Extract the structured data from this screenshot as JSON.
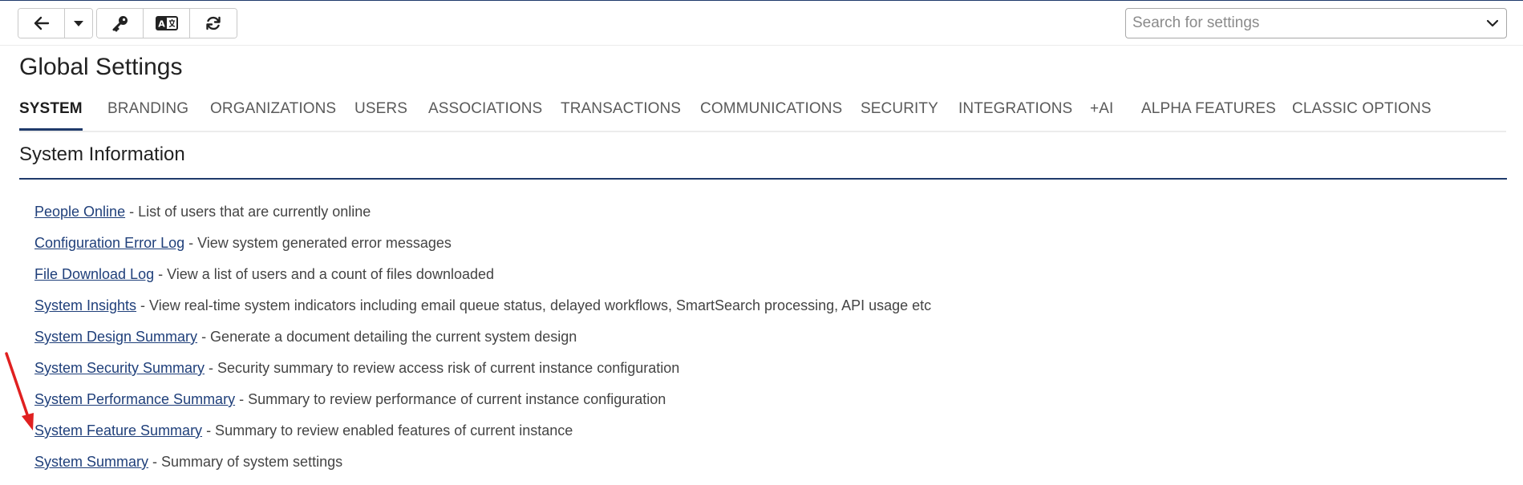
{
  "toolbar": {
    "buttons": [
      {
        "name": "back",
        "icon": "arrow-left-icon"
      },
      {
        "name": "history",
        "icon": "caret-down-icon"
      },
      {
        "name": "key",
        "icon": "key-icon"
      },
      {
        "name": "language",
        "icon": "translate-icon"
      },
      {
        "name": "refresh",
        "icon": "refresh-icon"
      }
    ]
  },
  "search": {
    "placeholder": "Search for settings"
  },
  "page": {
    "title": "Global Settings"
  },
  "tabs": [
    {
      "label": "SYSTEM",
      "active": true
    },
    {
      "label": "BRANDING",
      "active": false
    },
    {
      "label": "ORGANIZATIONS",
      "active": false
    },
    {
      "label": "USERS",
      "active": false
    },
    {
      "label": "ASSOCIATIONS",
      "active": false
    },
    {
      "label": "TRANSACTIONS",
      "active": false
    },
    {
      "label": "COMMUNICATIONS",
      "active": false
    },
    {
      "label": "SECURITY",
      "active": false
    },
    {
      "label": "INTEGRATIONS",
      "active": false
    },
    {
      "label": "+AI",
      "active": false
    },
    {
      "label": "ALPHA FEATURES",
      "active": false
    },
    {
      "label": "CLASSIC OPTIONS",
      "active": false
    }
  ],
  "section": {
    "title": "System Information"
  },
  "links": [
    {
      "label": "People Online",
      "description": " - List of users that are currently online"
    },
    {
      "label": "Configuration Error Log",
      "description": " - View system generated error messages"
    },
    {
      "label": "File Download Log",
      "description": " - View a list of users and a count of files downloaded"
    },
    {
      "label": "System Insights",
      "description": " - View real-time system indicators including email queue status, delayed workflows, SmartSearch processing, API usage etc"
    },
    {
      "label": "System Design Summary",
      "description": " - Generate a document detailing the current system design"
    },
    {
      "label": "System Security Summary",
      "description": " - Security summary to review access risk of current instance configuration"
    },
    {
      "label": "System Performance Summary",
      "description": " - Summary to review performance of current instance configuration"
    },
    {
      "label": "System Feature Summary",
      "description": " - Summary to review enabled features of current instance"
    },
    {
      "label": "System Summary",
      "description": " - Summary of system settings"
    }
  ],
  "colors": {
    "accent": "#1f3a6b",
    "link": "#1f3f7a",
    "annotation_arrow": "#e02020"
  }
}
